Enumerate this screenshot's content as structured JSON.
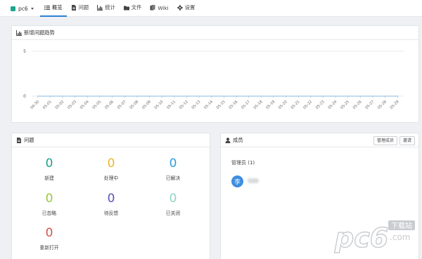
{
  "project": {
    "name": "pc6"
  },
  "nav": [
    {
      "id": "overview",
      "label": "概览",
      "icon": "list-icon",
      "active": true
    },
    {
      "id": "issues",
      "label": "问题",
      "icon": "document-icon",
      "active": false
    },
    {
      "id": "stats",
      "label": "统计",
      "icon": "bar-chart-icon",
      "active": false
    },
    {
      "id": "files",
      "label": "文件",
      "icon": "folder-icon",
      "active": false
    },
    {
      "id": "wiki",
      "label": "Wiki",
      "icon": "book-icon",
      "active": false
    },
    {
      "id": "settings",
      "label": "设置",
      "icon": "gear-icon",
      "active": false
    }
  ],
  "trend": {
    "title": "新增问题趋势"
  },
  "chart_data": {
    "type": "line",
    "categories": [
      "04-30",
      "05-01",
      "05-02",
      "05-03",
      "05-04",
      "05-05",
      "05-06",
      "05-07",
      "05-08",
      "05-09",
      "05-10",
      "05-11",
      "05-12",
      "05-13",
      "05-14",
      "05-15",
      "05-16",
      "05-17",
      "05-18",
      "05-19",
      "05-20",
      "05-21",
      "05-22",
      "05-23",
      "05-24",
      "05-25",
      "05-26",
      "05-27",
      "05-28",
      "05-29"
    ],
    "series": [
      {
        "values": [
          0,
          0,
          0,
          0,
          0,
          0,
          0,
          0,
          0,
          0,
          0,
          0,
          0,
          0,
          0,
          0,
          0,
          0,
          0,
          0,
          0,
          0,
          0,
          0,
          0,
          0,
          0,
          0,
          0,
          0
        ]
      }
    ],
    "yticks": [
      0,
      5
    ],
    "ylim": [
      0,
      5
    ],
    "grid": true,
    "color": "#9fc5e8"
  },
  "issues": {
    "title": "问题",
    "stats": [
      {
        "label": "新建",
        "value": "0",
        "color": "#1aa68a"
      },
      {
        "label": "处理中",
        "value": "0",
        "color": "#f0b429"
      },
      {
        "label": "已解决",
        "value": "0",
        "color": "#2f9fd6"
      },
      {
        "label": "已忽略",
        "value": "0",
        "color": "#9bc53d"
      },
      {
        "label": "待反馈",
        "value": "0",
        "color": "#5a55b4"
      },
      {
        "label": "已关闭",
        "value": "0",
        "color": "#8fd3c8"
      },
      {
        "label": "重新打开",
        "value": "0",
        "color": "#d9534f"
      }
    ]
  },
  "members": {
    "title": "成员",
    "manage_label": "管理成员",
    "invite_label": "邀请",
    "admin_label": "管理员 (1)",
    "admin_avatar": "李"
  },
  "watermark": {
    "logo": "pc6",
    "cn": "下载站",
    "com": ".com"
  }
}
